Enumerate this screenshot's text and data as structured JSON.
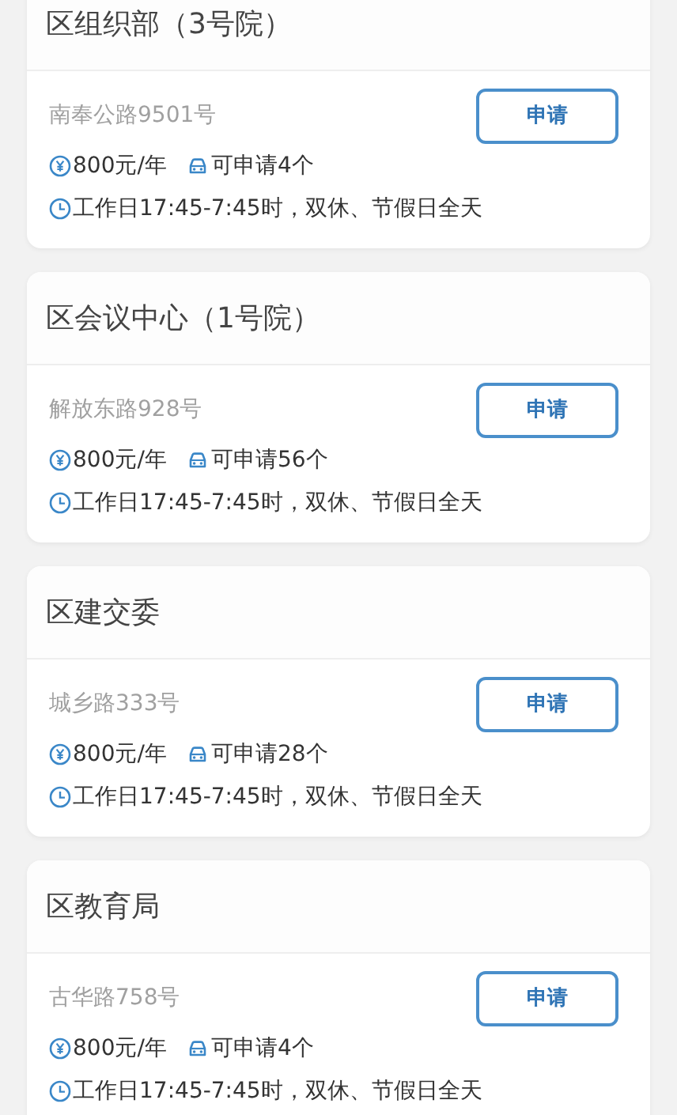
{
  "lots": [
    {
      "name": "区组织部（3号院）",
      "address": "南奉公路9501号",
      "button": "申请",
      "price": "800元/年",
      "available": "可申请4个",
      "hours": "工作日17:45-7:45时，双休、节假日全天"
    },
    {
      "name": "区会议中心（1号院）",
      "address": "解放东路928号",
      "button": "申请",
      "price": "800元/年",
      "available": "可申请56个",
      "hours": "工作日17:45-7:45时，双休、节假日全天"
    },
    {
      "name": "区建交委",
      "address": "城乡路333号",
      "button": "申请",
      "price": "800元/年",
      "available": "可申请28个",
      "hours": "工作日17:45-7:45时，双休、节假日全天"
    },
    {
      "name": "区教育局",
      "address": "古华路758号",
      "button": "申请",
      "price": "800元/年",
      "available": "可申请4个",
      "hours": "工作日17:45-7:45时，双休、节假日全天"
    }
  ]
}
